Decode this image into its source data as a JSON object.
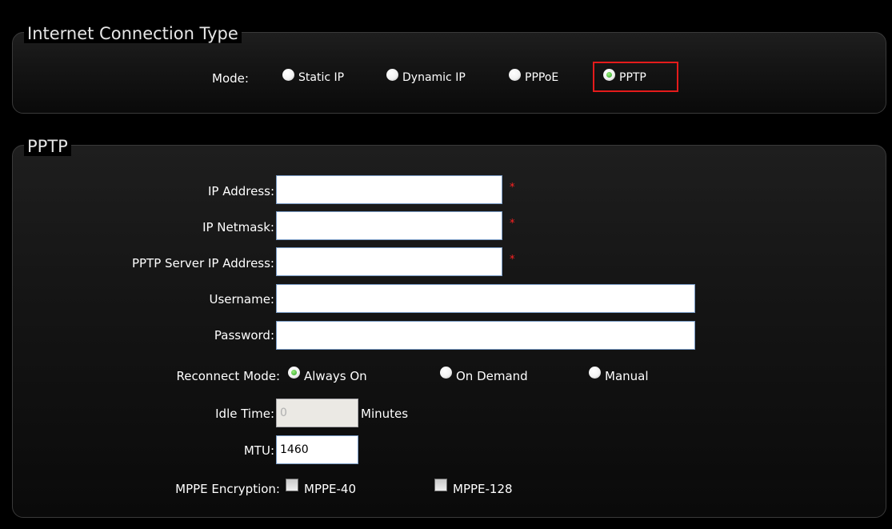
{
  "connection_type": {
    "title": "Internet Connection Type",
    "mode_label": "Mode:",
    "options": [
      {
        "label": "Static IP",
        "checked": false
      },
      {
        "label": "Dynamic IP",
        "checked": false
      },
      {
        "label": "PPPoE",
        "checked": false
      },
      {
        "label": "PPTP",
        "checked": true
      }
    ]
  },
  "pptp": {
    "title": "PPTP",
    "fields": {
      "ip_address": {
        "label": "IP Address:",
        "value": "",
        "required": "*"
      },
      "ip_netmask": {
        "label": "IP Netmask:",
        "value": "",
        "required": "*"
      },
      "server_ip": {
        "label": "PPTP Server IP Address:",
        "value": "",
        "required": "*"
      },
      "username": {
        "label": "Username:",
        "value": ""
      },
      "password": {
        "label": "Password:",
        "value": ""
      }
    },
    "reconnect_mode": {
      "label": "Reconnect Mode:",
      "options": [
        {
          "label": "Always On",
          "checked": true
        },
        {
          "label": "On Demand",
          "checked": false
        },
        {
          "label": "Manual",
          "checked": false
        }
      ]
    },
    "idle_time": {
      "label": "Idle Time:",
      "value": "0",
      "unit": "Minutes"
    },
    "mtu": {
      "label": "MTU:",
      "value": "1460"
    },
    "mppe": {
      "label": "MPPE Encryption:",
      "options": [
        {
          "label": "MPPE-40",
          "checked": false
        },
        {
          "label": "MPPE-128",
          "checked": false
        }
      ]
    }
  }
}
